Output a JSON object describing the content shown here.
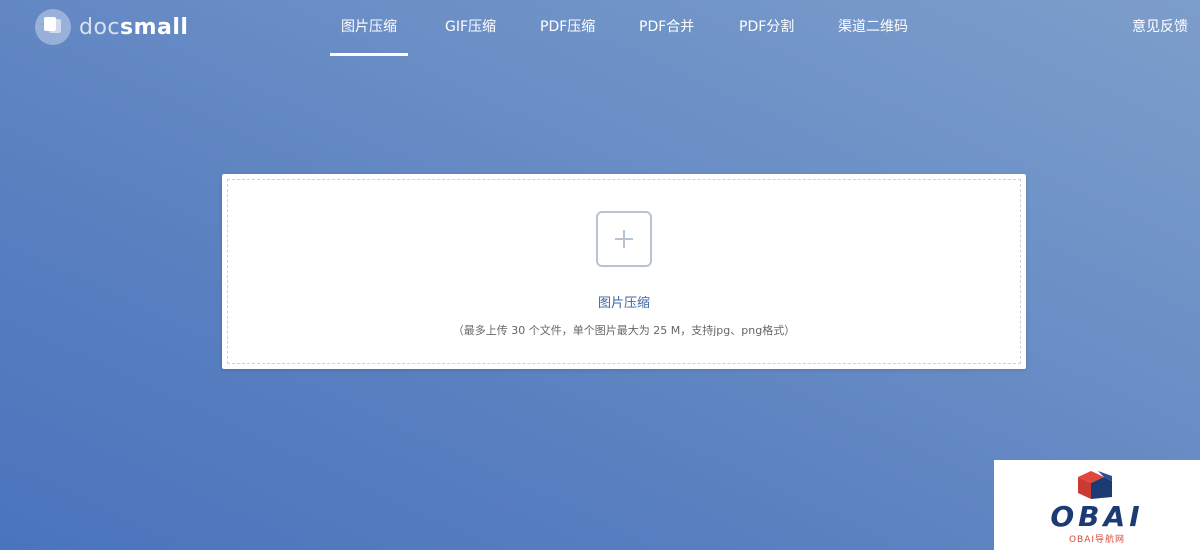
{
  "brand": {
    "logo_part1": "doc",
    "logo_part2": "small"
  },
  "nav": {
    "items": [
      {
        "label": "图片压缩",
        "active": true
      },
      {
        "label": "GIF压缩",
        "active": false
      },
      {
        "label": "PDF压缩",
        "active": false
      },
      {
        "label": "PDF合并",
        "active": false
      },
      {
        "label": "PDF分割",
        "active": false
      },
      {
        "label": "渠道二维码",
        "active": false
      }
    ],
    "feedback": "意见反馈"
  },
  "upload": {
    "title": "图片压缩",
    "hint": "（最多上传 30 个文件，单个图片最大为 25 M，支持jpg、png格式）"
  },
  "watermark": {
    "brand": "OBAI",
    "subtitle": "OBAI导航网"
  },
  "colors": {
    "background_start": "#7d9ecb",
    "background_end": "#4a74bd",
    "accent_text": "#3e66a3",
    "dashed_border": "#c9d3e0",
    "plus_icon": "#b7c3d3"
  },
  "icons": {
    "logo": "stacked-squares-icon",
    "upload": "plus-icon",
    "watermark": "cube-icon"
  }
}
